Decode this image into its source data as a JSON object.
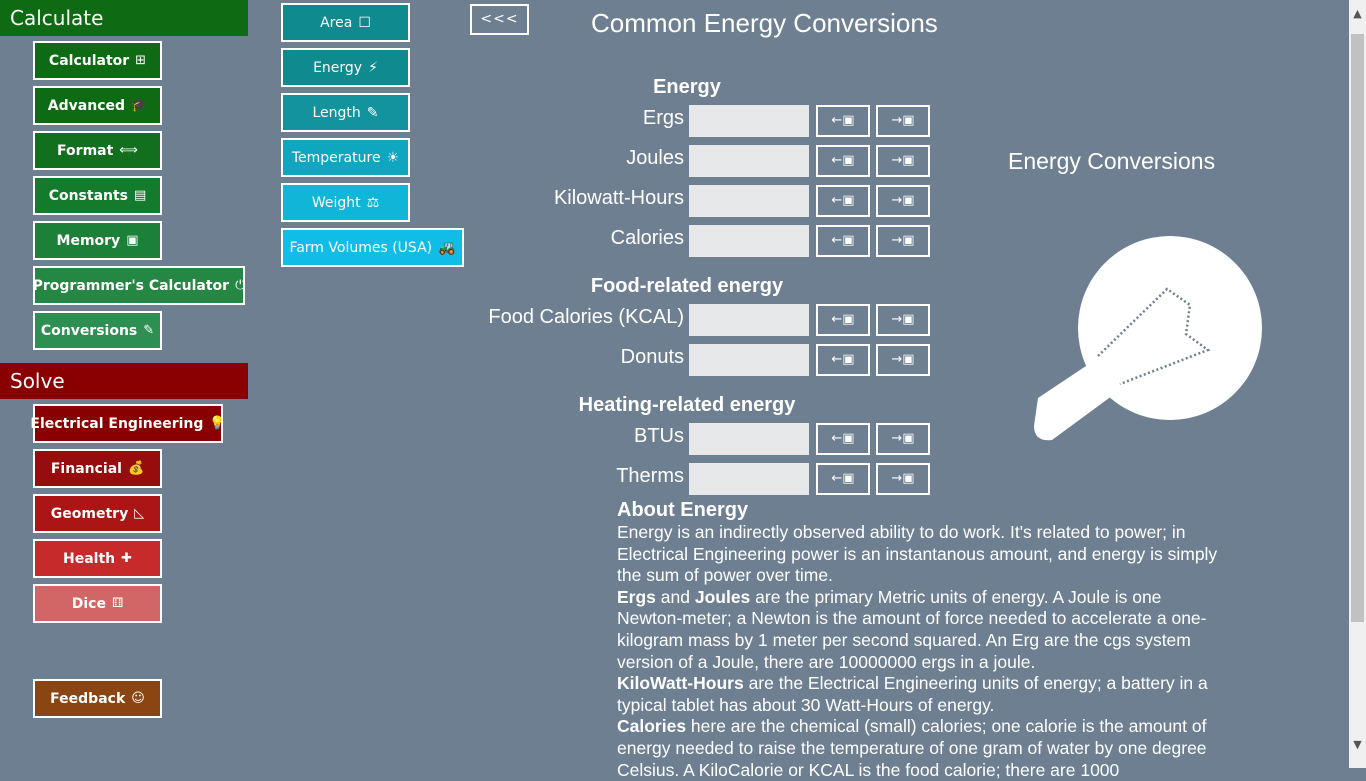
{
  "sidebar": {
    "calculate_header": "Calculate",
    "solve_header": "Solve",
    "calculate_items": [
      {
        "label": "Calculator",
        "icon": "⊞",
        "icon_name": "calculator-icon",
        "color": "#0f6a14"
      },
      {
        "label": "Advanced",
        "icon": "🎓",
        "icon_name": "graduation-cap-icon",
        "color": "#0f6a14"
      },
      {
        "label": "Format",
        "icon": "⟺",
        "icon_name": "double-arrow-icon",
        "color": "#116f1e"
      },
      {
        "label": "Constants",
        "icon": "▤",
        "icon_name": "list-box-icon",
        "color": "#147a2c"
      },
      {
        "label": "Memory",
        "icon": "▣",
        "icon_name": "memory-icon",
        "color": "#1d8038"
      },
      {
        "label": "Programmer's Calculator",
        "icon": "⏻",
        "icon_name": "chip-icon",
        "color": "#248744"
      },
      {
        "label": "Conversions",
        "icon": "✎",
        "icon_name": "pencil-icon",
        "color": "#2e8f52"
      }
    ],
    "solve_items": [
      {
        "label": "Electrical Engineering",
        "icon": "💡",
        "icon_name": "bulb-icon",
        "color": "#8a0000"
      },
      {
        "label": "Financial",
        "icon": "💰",
        "icon_name": "moneybag-icon",
        "color": "#970c0c"
      },
      {
        "label": "Geometry",
        "icon": "◺",
        "icon_name": "triangle-ruler-icon",
        "color": "#ac1515"
      },
      {
        "label": "Health",
        "icon": "✚",
        "icon_name": "health-icon",
        "color": "#c72a2a"
      },
      {
        "label": "Dice",
        "icon": "⚅",
        "icon_name": "dice-icon",
        "color": "#d26565"
      }
    ],
    "feedback": {
      "label": "Feedback",
      "icon": "☺",
      "icon_name": "person-icon",
      "color": "#8a4512"
    }
  },
  "conversion_categories": [
    {
      "label": "Area",
      "icon": "☐",
      "icon_name": "square-icon",
      "color": "#0f8a8e"
    },
    {
      "label": "Energy",
      "icon": "⚡",
      "icon_name": "lightning-icon",
      "color": "#0f8a8e"
    },
    {
      "label": "Length",
      "icon": "✎",
      "icon_name": "pencil-icon",
      "color": "#12939e"
    },
    {
      "label": "Temperature",
      "icon": "☀",
      "icon_name": "sun-icon",
      "color": "#0fa6c0"
    },
    {
      "label": "Weight",
      "icon": "⚖",
      "icon_name": "weight-icon",
      "color": "#0fb6d8"
    },
    {
      "label": "Farm Volumes (USA)",
      "icon": "🚜",
      "icon_name": "tractor-icon",
      "color": "#11bde6"
    }
  ],
  "header": {
    "back_label": "<<<",
    "title": "Common Energy Conversions"
  },
  "sections": [
    {
      "heading": "Energy",
      "rows": [
        {
          "label": "Ergs",
          "value": ""
        },
        {
          "label": "Joules",
          "value": ""
        },
        {
          "label": "Kilowatt-Hours",
          "value": ""
        },
        {
          "label": "Calories",
          "value": ""
        }
      ]
    },
    {
      "heading": "Food-related energy",
      "rows": [
        {
          "label": "Food Calories (KCAL)",
          "value": ""
        },
        {
          "label": "Donuts",
          "value": ""
        }
      ]
    },
    {
      "heading": "Heating-related energy",
      "rows": [
        {
          "label": "BTUs",
          "value": ""
        },
        {
          "label": "Therms",
          "value": ""
        }
      ]
    }
  ],
  "row_buttons": {
    "from_label": "←▣",
    "to_label": "→▣"
  },
  "aside": {
    "title": "Energy Conversions",
    "image_icon": "lightbulb-icon"
  },
  "about": {
    "heading": "About Energy",
    "paragraphs": [
      {
        "bold": "",
        "text": "Energy is an indirectly observed ability to do work. It's related to power; in Electrical Engineering power is an instantanous amount, and energy is simply the sum of power over time."
      },
      {
        "bold": "Ergs",
        "mid": " and ",
        "bold2": "Joules",
        "text": " are the primary Metric units of energy. A Joule is one Newton-meter; a Newton is the amount of force needed to accelerate a one-kilogram mass by 1 meter per second squared. An Erg are the cgs system version of a Joule, there are 10000000 ergs in a joule."
      },
      {
        "bold": "KiloWatt-Hours",
        "text": " are the Electrical Engineering units of energy; a battery in a typical tablet has about 30 Watt-Hours of energy."
      },
      {
        "bold": "Calories",
        "text": " here are the chemical (small) calories; one calorie is the amount of energy needed to raise the temperature of one gram of water by one degree Celsius. A KiloCalorie or KCAL is the food calorie; there are 1000"
      }
    ]
  },
  "scrollbar": {
    "up": "▲",
    "down": "▼"
  }
}
